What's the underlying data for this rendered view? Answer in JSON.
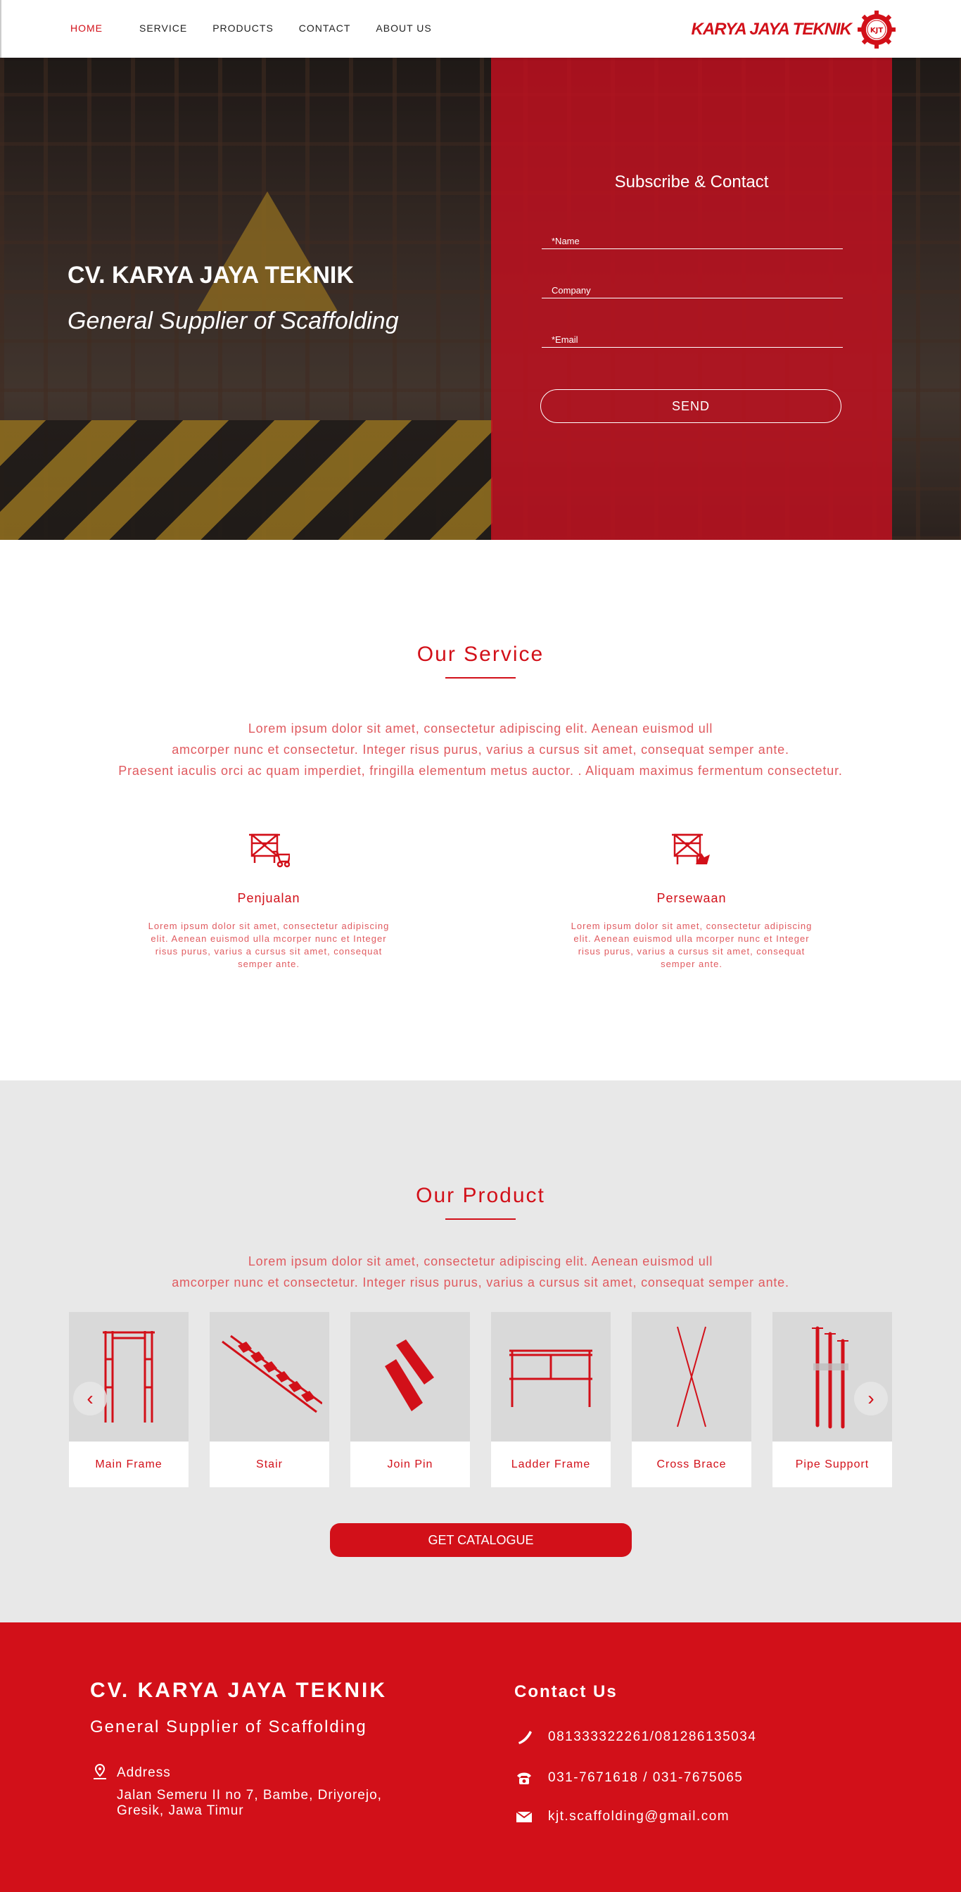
{
  "nav": {
    "items": [
      {
        "label": "HOME",
        "active": true
      },
      {
        "label": "SERVICE"
      },
      {
        "label": "PRODUCTS"
      },
      {
        "label": "CONTACT"
      },
      {
        "label": "ABOUT US"
      }
    ],
    "logo_text": "KARYA JAYA TEKNIK",
    "logo_mark": "KJT"
  },
  "hero": {
    "title": "CV. KARYA JAYA TEKNIK",
    "subtitle": "General Supplier of Scaffolding",
    "panel_title": "Subscribe & Contact",
    "fields": {
      "name_placeholder": "*Name",
      "company_placeholder": "Company",
      "email_placeholder": "*Email"
    },
    "send_label": "SEND"
  },
  "service": {
    "title": "Our Service",
    "desc": [
      "Lorem ipsum dolor sit amet, consectetur adipiscing elit. Aenean euismod ull",
      "amcorper nunc et consectetur. Integer risus purus, varius a cursus sit amet, consequat semper ante.",
      "Praesent iaculis orci ac quam imperdiet, fringilla elementum metus auctor. . Aliquam maximus fermentum consectetur."
    ],
    "items": [
      {
        "name": "Penjualan",
        "text": "Lorem ipsum dolor sit amet, consectetur adipiscing elit. Aenean euismod ulla mcorper nunc et Integer risus purus, varius a cursus sit amet, consequat semper ante."
      },
      {
        "name": "Persewaan",
        "text": "Lorem ipsum dolor sit amet, consectetur adipiscing elit. Aenean euismod ulla mcorper nunc et Integer risus purus, varius a cursus sit amet, consequat semper ante."
      }
    ]
  },
  "product": {
    "title": "Our Product",
    "desc": [
      "Lorem ipsum dolor sit amet, consectetur adipiscing elit. Aenean euismod ull",
      "amcorper nunc et consectetur. Integer risus purus, varius a cursus sit amet, consequat semper ante."
    ],
    "items": [
      {
        "label": "Main Frame",
        "icon": "main-frame-icon"
      },
      {
        "label": "Stair",
        "icon": "stair-icon"
      },
      {
        "label": "Join Pin",
        "icon": "join-pin-icon"
      },
      {
        "label": "Ladder Frame",
        "icon": "ladder-frame-icon"
      },
      {
        "label": "Cross Brace",
        "icon": "cross-brace-icon"
      },
      {
        "label": "Pipe Support",
        "icon": "pipe-support-icon"
      }
    ],
    "prev_icon": "‹",
    "next_icon": "›",
    "catalogue_label": "GET CATALOGUE"
  },
  "footer": {
    "title": "CV. KARYA JAYA TEKNIK",
    "subtitle": "General Supplier of Scaffolding",
    "address_label": "Address",
    "address": "Jalan Semeru II no 7, Bambe, Driyorejo, Gresik, Jawa Timur",
    "contact_title": "Contact Us",
    "mobile": "081333322261/081286135034",
    "phone": "031-7671618 / 031-7675065",
    "email": "kjt.scaffolding@gmail.com"
  },
  "colors": {
    "brand": "#d21019",
    "panel": "#c41020",
    "product_bg": "#e8e8e8"
  }
}
